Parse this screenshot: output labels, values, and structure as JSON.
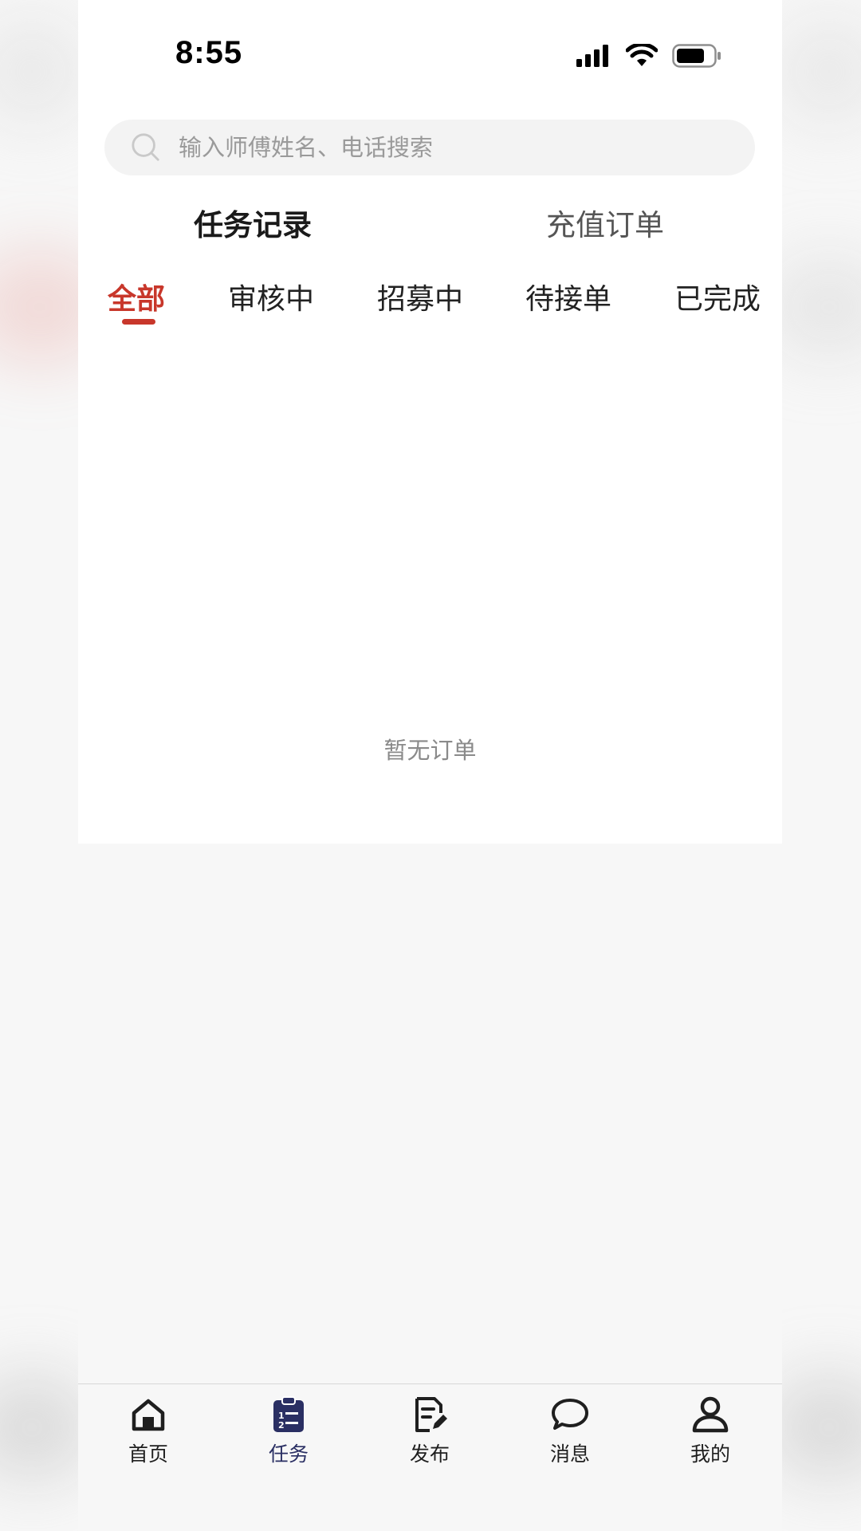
{
  "status_bar": {
    "time": "8:55"
  },
  "search": {
    "placeholder": "输入师傅姓名、电话搜索"
  },
  "main_tabs": [
    {
      "label": "任务记录",
      "active": true
    },
    {
      "label": "充值订单",
      "active": false
    }
  ],
  "filter_tabs": [
    {
      "label": "全部",
      "active": true
    },
    {
      "label": "审核中",
      "active": false
    },
    {
      "label": "招募中",
      "active": false
    },
    {
      "label": "待接单",
      "active": false
    },
    {
      "label": "已完成",
      "active": false
    }
  ],
  "empty_state": {
    "text": "暂无订单"
  },
  "bottom_nav": [
    {
      "label": "首页",
      "icon": "home-icon",
      "active": false
    },
    {
      "label": "任务",
      "icon": "task-clipboard-icon",
      "active": true
    },
    {
      "label": "发布",
      "icon": "publish-document-icon",
      "active": false
    },
    {
      "label": "消息",
      "icon": "message-bubble-icon",
      "active": false
    },
    {
      "label": "我的",
      "icon": "user-profile-icon",
      "active": false
    }
  ],
  "colors": {
    "accent_red": "#c8372b",
    "nav_active": "#2a2f63",
    "search_bg": "#f3f3f3"
  }
}
